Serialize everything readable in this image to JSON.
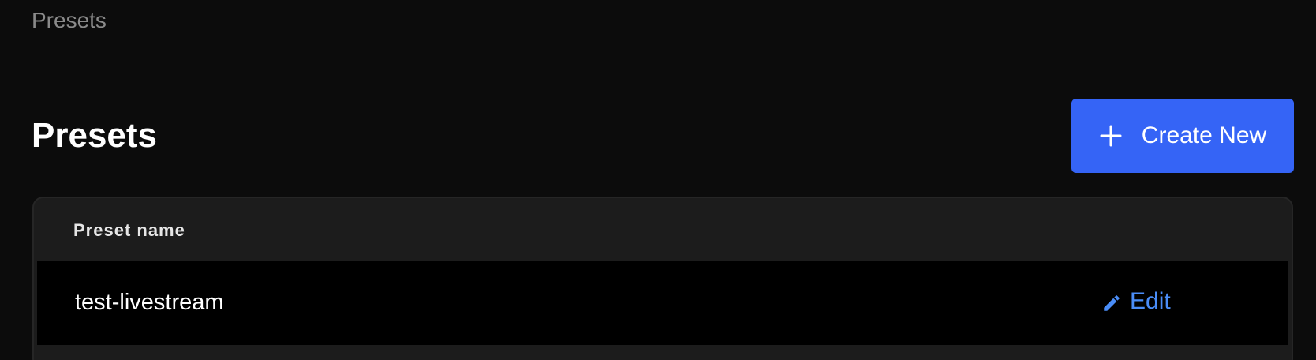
{
  "breadcrumb": {
    "current": "Presets"
  },
  "page": {
    "title": "Presets"
  },
  "toolbar": {
    "create_label": "Create New",
    "create_icon": "plus-icon"
  },
  "table": {
    "columns": [
      "Preset name"
    ],
    "rows": [
      {
        "name": "test-livestream",
        "action_label": "Edit",
        "action_icon": "pencil-icon"
      }
    ]
  },
  "colors": {
    "background": "#0c0c0c",
    "accent": "#3564f6",
    "link": "#4a8df8",
    "card": "#1c1c1c",
    "row": "#000000",
    "muted_text": "#8a8a8a"
  }
}
